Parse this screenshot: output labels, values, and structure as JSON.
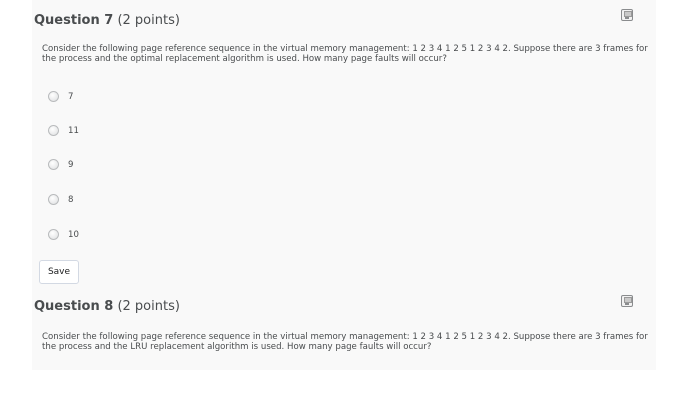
{
  "questions": [
    {
      "number_label": "Question 7",
      "points_label": "(2 points)",
      "prompt": "Consider the following page reference sequence in the virtual memory management: 1 2 3 4 1 2 5 1 2 3 4 2. Suppose there are 3 frames for the process and the optimal replacement algorithm is used. How many page faults will occur?",
      "options": [
        "7",
        "11",
        "9",
        "8",
        "10"
      ],
      "save_label": "Save"
    },
    {
      "number_label": "Question 8",
      "points_label": "(2 points)",
      "prompt": "Consider the following page reference sequence in the virtual memory management: 1 2 3 4 1 2 5 1 2 3 4 2. Suppose there are 3 frames for the process and the LRU replacement algorithm is used. How many page faults will occur?"
    }
  ],
  "icons": {
    "save_status": "floppy-disk-icon"
  },
  "colors": {
    "panel_bg": "#f9f9f9",
    "text": "#494c4e"
  }
}
